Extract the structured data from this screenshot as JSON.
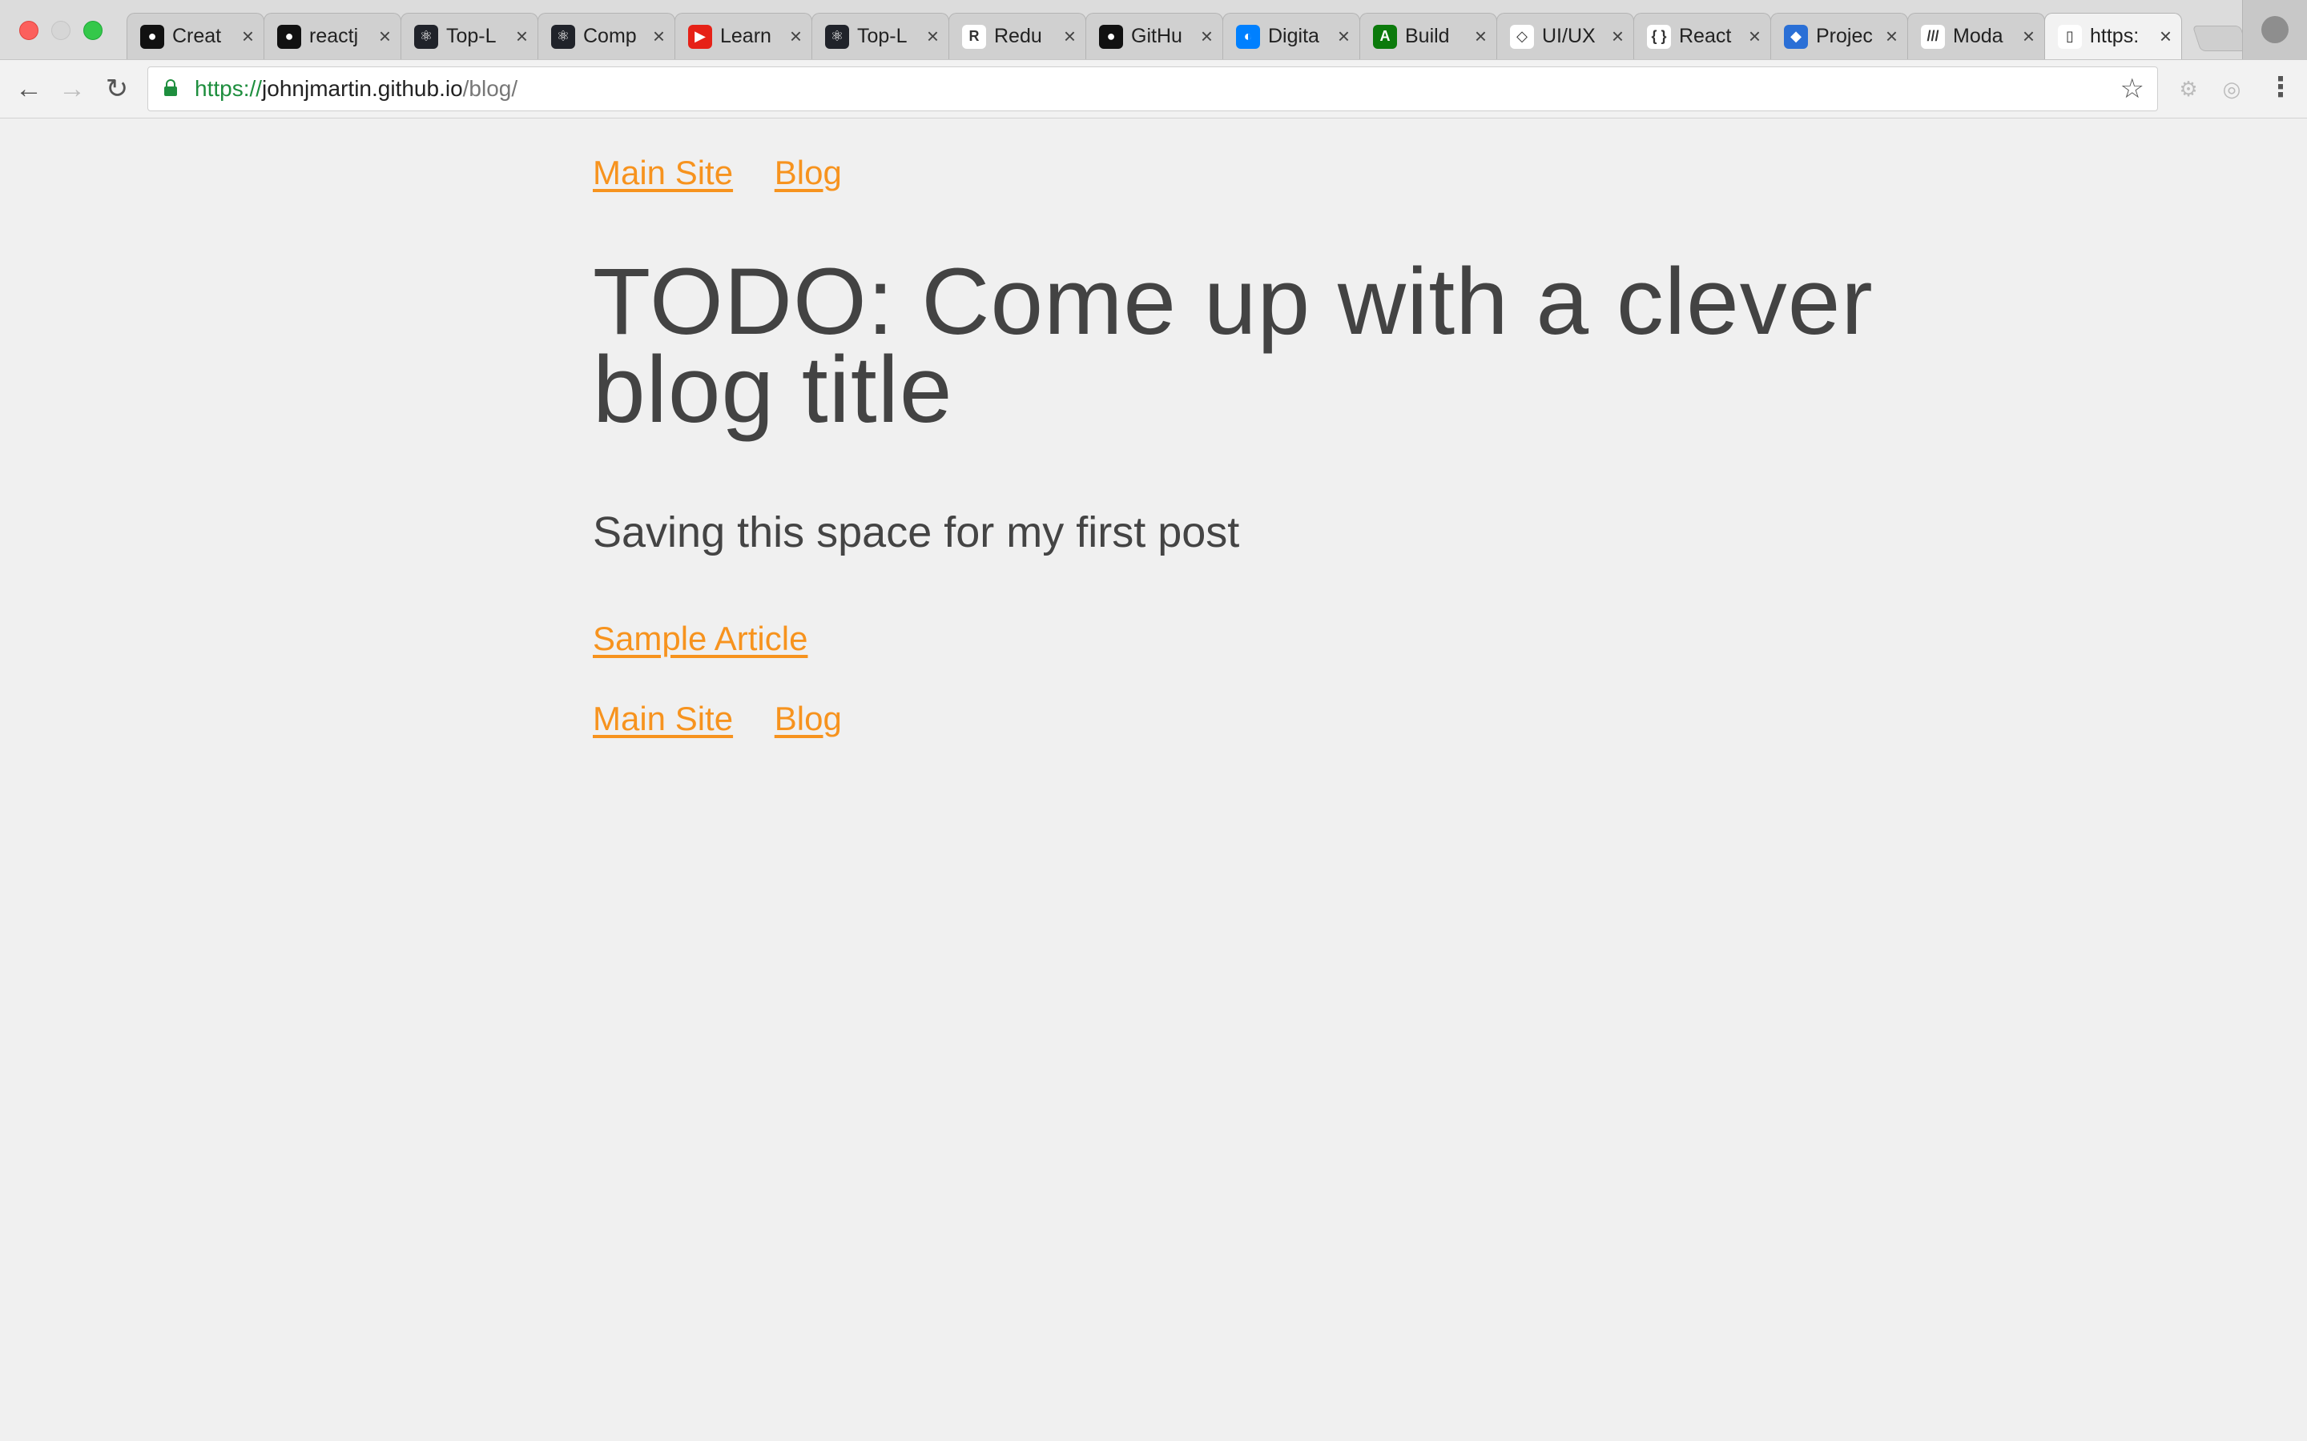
{
  "browser": {
    "tabs": [
      {
        "title": "Creat",
        "icon": "github-icon",
        "color": "#111111",
        "glyph": "●"
      },
      {
        "title": "reactj",
        "icon": "github-icon",
        "color": "#111111",
        "glyph": "●"
      },
      {
        "title": "Top-L",
        "icon": "react-icon",
        "color": "#20232a",
        "glyph": "⚛"
      },
      {
        "title": "Comp",
        "icon": "react-icon",
        "color": "#20232a",
        "glyph": "⚛"
      },
      {
        "title": "Learn",
        "icon": "youtube-icon",
        "color": "#e62117",
        "glyph": "▶"
      },
      {
        "title": "Top-L",
        "icon": "react-icon",
        "color": "#20232a",
        "glyph": "⚛"
      },
      {
        "title": "Redu",
        "icon": "redux-icon",
        "color": "#ffffff",
        "glyph": "R"
      },
      {
        "title": "GitHu",
        "icon": "github-icon",
        "color": "#111111",
        "glyph": "●"
      },
      {
        "title": "Digita",
        "icon": "digitalocean-icon",
        "color": "#0080ff",
        "glyph": "◐"
      },
      {
        "title": "Build",
        "icon": "android-icon",
        "color": "#0b7a0b",
        "glyph": "A"
      },
      {
        "title": "UI/UX",
        "icon": "codepen-icon",
        "color": "#ffffff",
        "glyph": "◇"
      },
      {
        "title": "React",
        "icon": "braces-icon",
        "color": "#ffffff",
        "glyph": "{ }"
      },
      {
        "title": "Projec",
        "icon": "leaf-icon",
        "color": "#2a6fd6",
        "glyph": "◆"
      },
      {
        "title": "Moda",
        "icon": "stripes-icon",
        "color": "#ffffff",
        "glyph": "///"
      },
      {
        "title": "https:",
        "icon": "page-icon",
        "color": "#ffffff",
        "glyph": "▯"
      }
    ],
    "url": {
      "scheme": "https://",
      "host": "johnjmartin.github.io",
      "path": "/blog/"
    }
  },
  "page": {
    "nav_top": {
      "main_site": "Main Site",
      "blog": "Blog"
    },
    "title": "TODO: Come up with a clever blog title",
    "lede": "Saving this space for my first post",
    "articles": [
      "Sample Article"
    ],
    "nav_bottom": {
      "main_site": "Main Site",
      "blog": "Blog"
    },
    "link_color": "#f7931e",
    "text_color": "#444444"
  }
}
